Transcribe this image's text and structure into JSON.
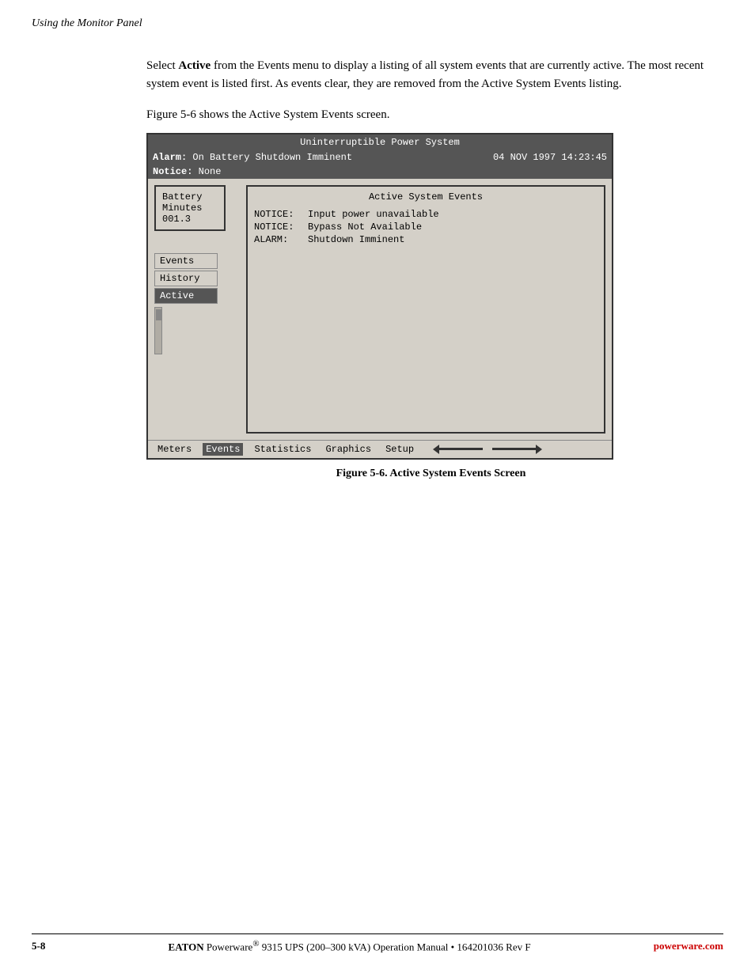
{
  "header": {
    "section_title": "Using the Monitor Panel"
  },
  "intro": {
    "paragraph1": "Select ",
    "bold1": "Active",
    "paragraph1b": " from the Events menu to display a listing of all system events that are currently active. The most recent system event is listed first. As events clear, they are removed from the Active System Events listing.",
    "figure_ref": "Figure 5-6 shows the Active System Events screen."
  },
  "screen": {
    "title": "Uninterruptible Power System",
    "status_date": "04 NOV 1997",
    "status_time": "14:23:45",
    "alarm_label": "Alarm:",
    "alarm_value": "On Battery",
    "shutdown_label": "Shutdown Imminent",
    "notice_label": "Notice:",
    "notice_value": "None",
    "battery_box": {
      "line1": "Battery",
      "line2": "Minutes",
      "line3": "001.3"
    },
    "menu_items": [
      {
        "label": "Events",
        "active": false
      },
      {
        "label": "History",
        "active": false
      },
      {
        "label": "Active",
        "active": true
      }
    ],
    "active_events": {
      "title": "Active System Events",
      "events": [
        {
          "type": "NOTICE:",
          "message": "Input power unavailable"
        },
        {
          "type": "NOTICE:",
          "message": "Bypass Not Available"
        },
        {
          "type": "ALARM:",
          "message": "Shutdown Imminent"
        }
      ]
    },
    "bottom_menu": {
      "items": [
        {
          "label": "Meters",
          "selected": false
        },
        {
          "label": "Events",
          "selected": true
        },
        {
          "label": "Statistics",
          "selected": false
        },
        {
          "label": "Graphics",
          "selected": false
        },
        {
          "label": "Setup",
          "selected": false
        }
      ]
    }
  },
  "figure_caption": "Figure 5-6. Active System Events Screen",
  "footer": {
    "page_number": "5-8",
    "center_text": "Powerware",
    "center_reg": "®",
    "center_model": " 9315 UPS (200–300 kVA) Operation Manual  •  164201036 Rev F",
    "brand_prefix": "EATON",
    "brand_suffix": "powerware.com"
  }
}
